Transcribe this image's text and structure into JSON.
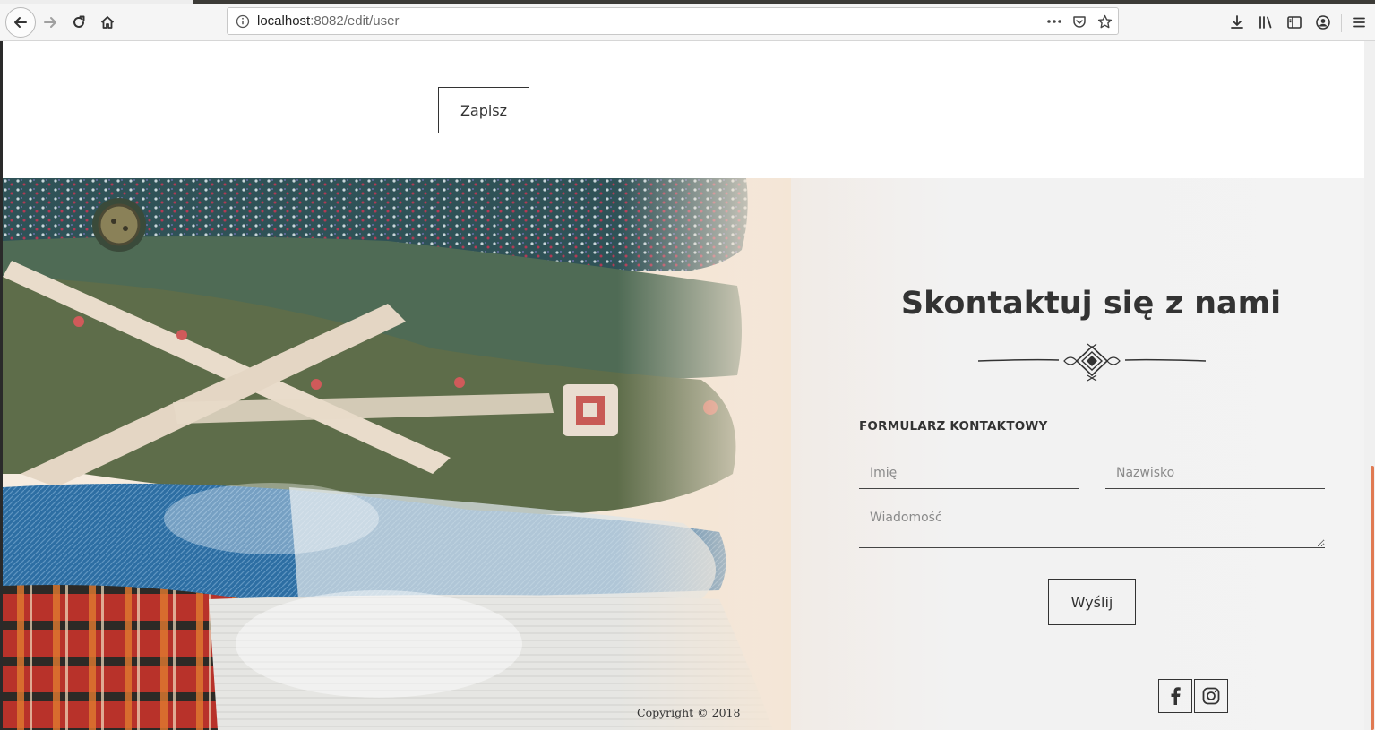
{
  "browser": {
    "url_host": "localhost",
    "url_rest": ":8082/edit/user",
    "toolbar_icons": [
      "back-icon",
      "forward-icon",
      "reload-icon",
      "home-icon",
      "info-icon",
      "more-icon",
      "pocket-icon",
      "bookmark-star-icon",
      "download-icon",
      "library-icon",
      "sidebar-icon",
      "account-icon",
      "menu-icon"
    ]
  },
  "page": {
    "save_label": "Zapisz"
  },
  "contact": {
    "title": "Skontaktuj się z nami",
    "form_label": "FORMULARZ KONTAKTOWY",
    "first_name_placeholder": "Imię",
    "last_name_placeholder": "Nazwisko",
    "message_placeholder": "Wiadomość",
    "send_label": "Wyślij",
    "social": [
      "facebook-icon",
      "instagram-icon"
    ],
    "image": "folded-sweaters-and-jeans-photo"
  },
  "footer": {
    "copyright": "Copyright © 2018"
  },
  "colors": {
    "accent_scroll": "#e07a52",
    "text": "#333333",
    "chrome": "#f5f5f5"
  }
}
